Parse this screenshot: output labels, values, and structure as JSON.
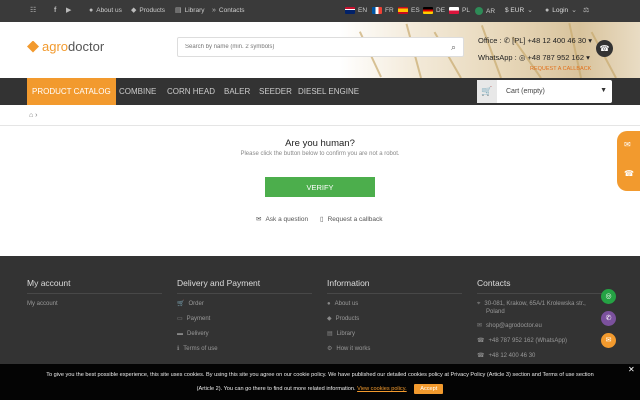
{
  "topbar": {
    "about": "About us",
    "products": "Products",
    "library": "Library",
    "contacts": "Contacts",
    "languages": [
      "EN",
      "FR",
      "ES",
      "DE",
      "PL",
      "AR"
    ],
    "currency": "$ EUR",
    "login": "Login"
  },
  "header": {
    "logo_agro": "agro",
    "logo_doctor": "doctor",
    "search_placeholder": "Search by name (min. 2 symbols)",
    "office_label": "Office :",
    "office_phone": "[PL] +48 12 400 46 30",
    "whatsapp_label": "WhatsApp :",
    "whatsapp_phone": "+48 787 952 162",
    "callback": "REQUEST A CALLBACK"
  },
  "nav": {
    "tabs": [
      "PRODUCT CATALOG",
      "COMBINE",
      "CORN HEAD",
      "BALER",
      "SEEDER",
      "DIESEL ENGINE"
    ],
    "cart": "Cart (empty)"
  },
  "content": {
    "title": "Are you human?",
    "subtitle": "Please click the button below to confirm you are not a robot.",
    "verify": "VERIFY",
    "ask": "Ask a question",
    "callback": "Request a callback"
  },
  "footer": {
    "account": {
      "title": "My account",
      "items": [
        "My account"
      ]
    },
    "delivery": {
      "title": "Delivery and Payment",
      "items": [
        "Order",
        "Payment",
        "Delivery",
        "Terms of use"
      ]
    },
    "info": {
      "title": "Information",
      "items": [
        "About us",
        "Products",
        "Library",
        "How it works"
      ]
    },
    "contacts": {
      "title": "Contacts",
      "address1": "30-081, Krakow, 65A/1 Krolewska str.,",
      "address2": "Poland",
      "email": "shop@agrodoctor.eu",
      "whatsapp": "+48 787 952 162 (WhatsApp)",
      "phone": "+48 12 400 46 30"
    }
  },
  "cookie": {
    "line1": "To give you the best possible experience, this site uses cookies. By using this site you agree on our cookie policy. We have published our detailed cookies policy at Privacy Policy (Article 3) section and Terms of use section",
    "line2": "(Article 2). You can go there to find out more related information.",
    "link": "View cookies policy.",
    "accept": "Accept"
  },
  "colors": {
    "accent": "#f29a2e",
    "dark": "#333333",
    "verify": "#4cae4c"
  }
}
